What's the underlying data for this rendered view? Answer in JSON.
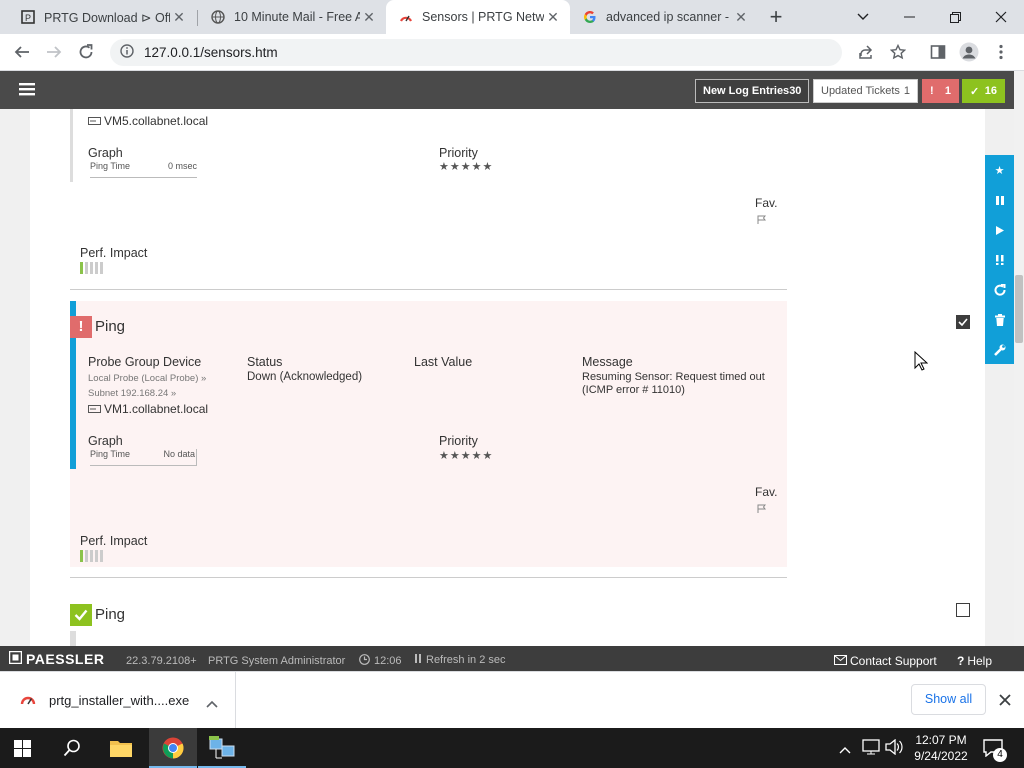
{
  "browser": {
    "tabs": [
      {
        "title": "PRTG Download ⊳ Offi",
        "favicon": "prtg-icon"
      },
      {
        "title": "10 Minute Mail - Free A",
        "favicon": "globe-icon"
      },
      {
        "title": "Sensors | PRTG Networ",
        "favicon": "prtg-gauge-icon"
      },
      {
        "title": "advanced ip scanner -",
        "favicon": "google-icon"
      }
    ],
    "url": "127.0.0.1/sensors.htm"
  },
  "header": {
    "new_log_label": "New Log Entries",
    "new_log_count": "30",
    "tickets_label": "Updated Tickets",
    "tickets_count": "1",
    "alarm_count": "1",
    "ok_count": "16"
  },
  "sensor_top": {
    "device": "VM5.collabnet.local",
    "graph_label": "Graph",
    "graph_metric": "Ping Time",
    "graph_value": "0 msec",
    "priority_label": "Priority",
    "priority_stars": "★★★★★",
    "fav_label": "Fav.",
    "perf_label": "Perf. Impact"
  },
  "sensor_down": {
    "name": "Ping",
    "col_device": "Probe Group Device",
    "col_status": "Status",
    "col_last": "Last Value",
    "col_message": "Message",
    "probe_path1": "Local Probe (Local Probe) »",
    "probe_path2": "Subnet 192.168.24 »",
    "device": "VM1.collabnet.local",
    "status": "Down (Acknowledged)",
    "message": "Resuming Sensor: Request timed out (ICMP error # 11010)",
    "graph_label": "Graph",
    "graph_metric": "Ping Time",
    "graph_value": "No data",
    "priority_label": "Priority",
    "priority_stars": "★★★★★",
    "fav_label": "Fav.",
    "perf_label": "Perf. Impact"
  },
  "sensor_next": {
    "name": "Ping"
  },
  "footer": {
    "brand": "PAESSLER",
    "version": "22.3.79.2108+",
    "user": "PRTG System Administrator",
    "time": "12:06",
    "refresh": "Refresh in 2 sec",
    "contact": "Contact Support",
    "help": "Help"
  },
  "download": {
    "filename": "prtg_installer_with....exe",
    "show_all": "Show all"
  },
  "taskbar": {
    "time": "12:07 PM",
    "date": "9/24/2022",
    "notif_count": "4"
  },
  "colors": {
    "accent": "#119fd8",
    "alarm": "#e06c6c",
    "ok": "#8dc21f",
    "header": "#4a4a4a"
  }
}
